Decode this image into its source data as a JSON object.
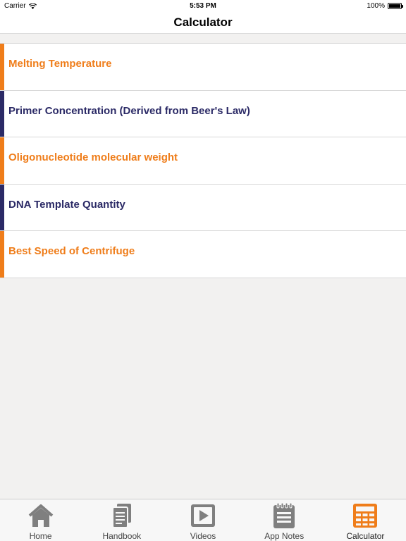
{
  "status_bar": {
    "carrier": "Carrier",
    "time": "5:53 PM",
    "battery": "100%"
  },
  "nav": {
    "title": "Calculator"
  },
  "colors": {
    "orange": "#ef7d1a",
    "navy": "#2b2a66",
    "tab_gray": "#7f7f7f"
  },
  "items": [
    {
      "label": "Melting Temperature",
      "accent": "orange"
    },
    {
      "label": "Primer Concentration (Derived from Beer's Law)",
      "accent": "navy"
    },
    {
      "label": "Oligonucleotide molecular weight",
      "accent": "orange"
    },
    {
      "label": "DNA Template Quantity",
      "accent": "navy"
    },
    {
      "label": "Best Speed of Centrifuge",
      "accent": "orange"
    }
  ],
  "tabs": [
    {
      "label": "Home",
      "icon": "home-icon"
    },
    {
      "label": "Handbook",
      "icon": "handbook-icon"
    },
    {
      "label": "Videos",
      "icon": "video-icon"
    },
    {
      "label": "App Notes",
      "icon": "notes-icon"
    },
    {
      "label": "Calculator",
      "icon": "calculator-icon",
      "active": true
    }
  ]
}
